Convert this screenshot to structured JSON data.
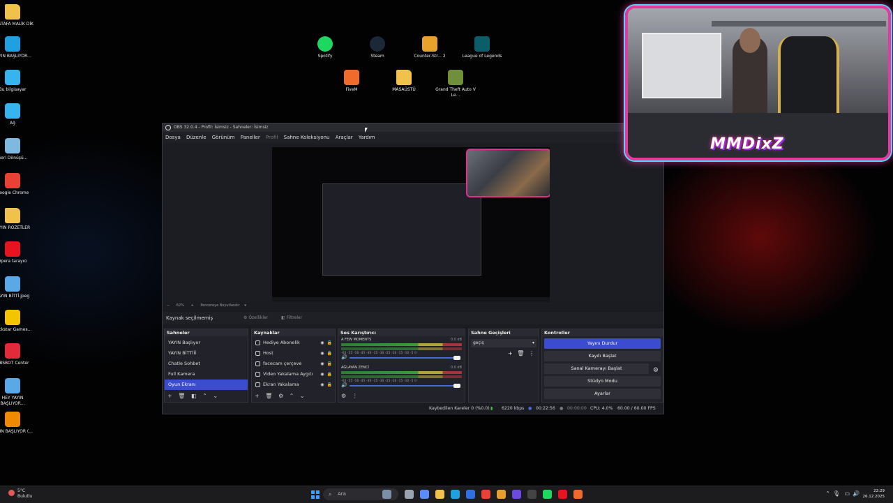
{
  "desktop": {
    "left_icons": [
      {
        "label": "MUSTAFA MALİK DİK",
        "icon": "folder-user-icon",
        "color": "#f0c24b"
      },
      {
        "label": "YAYIN BAŞLIYOR...",
        "icon": "edge-icon",
        "color": "#1fa0e0"
      },
      {
        "label": "Bu bilgisayar",
        "icon": "monitor-icon",
        "color": "#35b4f0"
      },
      {
        "label": "Ağ",
        "icon": "network-icon",
        "color": "#35b4f0"
      },
      {
        "label": "Geri Dönüşü...",
        "icon": "recycle-bin-icon",
        "color": "#7fb8e0"
      },
      {
        "label": "Google Chrome",
        "icon": "chrome-icon",
        "color": "#e94235"
      },
      {
        "label": "YAYIN ROZETLER",
        "icon": "folder-icon",
        "color": "#f0c24b"
      },
      {
        "label": "Opera tarayıcı",
        "icon": "opera-icon",
        "color": "#e5141f"
      },
      {
        "label": "YAYIN BİTTİ.jpeg",
        "icon": "image-file-icon",
        "color": "#5aa9e6"
      },
      {
        "label": "Rockstar Games...",
        "icon": "rockstar-icon",
        "color": "#f5c400"
      },
      {
        "label": "OBSBOT Center",
        "icon": "obsbot-icon",
        "color": "#e22b3a"
      },
      {
        "label": "HEY YAYIN BAŞLIYOR...",
        "icon": "image-file-icon",
        "color": "#5aa9e6"
      },
      {
        "label": "YAYIN BAŞLIYOR (...",
        "icon": "vlc-icon",
        "color": "#f08a00"
      }
    ],
    "center_icons": [
      {
        "label": "Spotify",
        "icon": "spotify-icon",
        "color": "#1ed760"
      },
      {
        "label": "Steam",
        "icon": "steam-icon",
        "color": "#1b2838"
      },
      {
        "label": "Counter-Str... 2",
        "icon": "cs2-icon",
        "color": "#e8a12a"
      },
      {
        "label": "League of Legends",
        "icon": "lol-icon",
        "color": "#0b5e68"
      },
      {
        "label": "FiveM",
        "icon": "fivem-icon",
        "color": "#f06b2b"
      },
      {
        "label": "MASAÜSTÜ",
        "icon": "folder-icon",
        "color": "#f0c24b"
      },
      {
        "label": "Grand Theft Auto V Le...",
        "icon": "gta-icon",
        "color": "#6f8f3a"
      }
    ]
  },
  "obs": {
    "title": "OBS 32.0.4 - Profil: İsimsiz - Sahneler: İsimsiz",
    "menu": [
      "Dosya",
      "Düzenle",
      "Görünüm",
      "Paneller",
      "Profil",
      "Sahne Koleksiyonu",
      "Araçlar",
      "Yardım"
    ],
    "zoom_text": "62%",
    "fit_text": "Pencereye Boyutlandır",
    "source_label": "Kaynak seçilmemiş",
    "properties_label": "Özellikler",
    "filters_label": "Filtreler",
    "scenes": {
      "title": "Sahneler",
      "items": [
        "YAYIN Başlıyor",
        "YAYIN BİTTİİİ",
        "Chatle Sohbet",
        "Full Kamera",
        "Oyun Ekranı"
      ],
      "selected": 4
    },
    "sources": {
      "title": "Kaynaklar",
      "items": [
        "Hediye Abonelik",
        "Host",
        "facecam çerçeve",
        "Video Yakalama Aygıtı",
        "Ekran Yakalama"
      ]
    },
    "mixer": {
      "title": "Ses Karıştırıcı",
      "channels": [
        {
          "name": "A FEW MOMENTS",
          "db": "0.0 dB"
        },
        {
          "name": "AĞLAYAN ZENCİ",
          "db": "0.0 dB"
        }
      ],
      "scale": "-60 -55 -50 -45 -40 -35 -30 -25 -20 -15 -10 -5 0"
    },
    "transitions": {
      "title": "Sahne Geçişleri",
      "value": "geçiş"
    },
    "controls": {
      "title": "Kontroller",
      "buttons": [
        "Yayını Durdur",
        "Kaydı Başlat",
        "Sanal Kamerayı Başlat",
        "Stüdyo Modu",
        "Ayarlar"
      ]
    },
    "status": {
      "dropped": "Kaybedilen Kareler 0 (%0.0)",
      "bitrate": "6220 kbps",
      "stream_time": "00:22:56",
      "rec_time": "00:00:00",
      "cpu": "CPU: 4.0%",
      "fps": "60.00 / 60.00 FPS"
    }
  },
  "webcam": {
    "logo_text": "MMDixZ"
  },
  "taskbar": {
    "weather_temp": "5°C",
    "weather_desc": "Bulutlu",
    "search_placeholder": "Ara",
    "time": "22:29",
    "date": "26.12.2025"
  }
}
